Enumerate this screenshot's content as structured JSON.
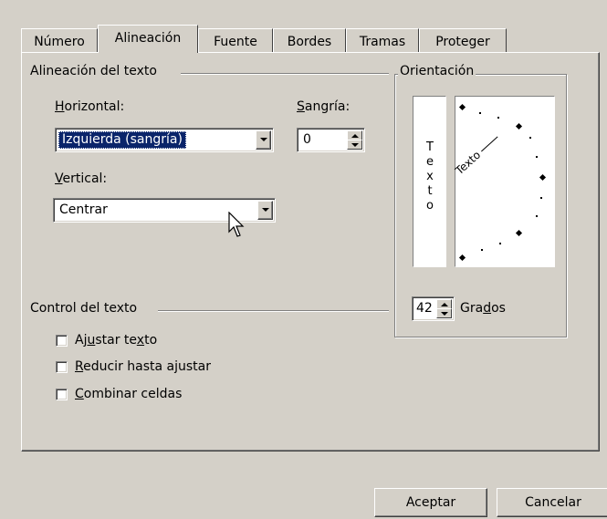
{
  "tabs": [
    "Número",
    "Alineación",
    "Fuente",
    "Bordes",
    "Tramas",
    "Proteger"
  ],
  "alignment": {
    "group_title": "Alineación del texto",
    "horizontal_label": "Horizontal:",
    "horizontal_value": "Izquierda (sangría)",
    "indent_label": "Sangría:",
    "indent_value": "0",
    "vertical_label": "Vertical:",
    "vertical_value": "Centrar"
  },
  "orientation": {
    "group_title": "Orientación",
    "vertical_letters": [
      "T",
      "e",
      "x",
      "t",
      "o"
    ],
    "rotated_text": "Texto",
    "degrees_value": "42",
    "degrees_label": "Grados"
  },
  "text_control": {
    "group_title": "Control del texto",
    "wrap_label": "Ajustar texto",
    "shrink_label": "Reducir hasta ajustar",
    "merge_label": "Combinar celdas"
  },
  "buttons": {
    "ok": "Aceptar",
    "cancel": "Cancelar"
  },
  "colors": {
    "face": "#d4d0c8",
    "selection": "#0a246a"
  }
}
